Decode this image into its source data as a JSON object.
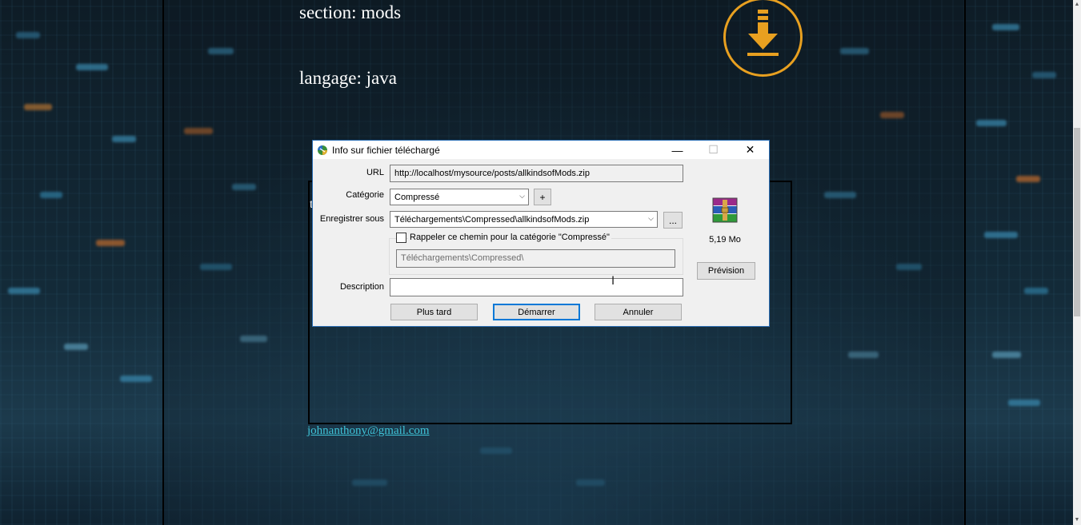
{
  "page": {
    "section_line": "section:  mods",
    "language_line": "langage:  java",
    "box_letter": "t",
    "email": "johnanthony@gmail.com"
  },
  "icons": {
    "download": "download-circle-icon",
    "app": "internet-download-manager-icon",
    "archive": "winrar-archive-icon",
    "minimize": "minimize-icon",
    "maximize": "maximize-icon",
    "close": "close-icon",
    "dropdown": "chevron-down-icon"
  },
  "colors": {
    "accent_orange": "#e8a020",
    "link_cyan": "#3fc3d8",
    "default_button_border": "#0078d7"
  },
  "dialog": {
    "title": "Info sur fichier téléchargé",
    "minimize_glyph": "—",
    "maximize_glyph": "☐",
    "close_glyph": "✕",
    "url_label": "URL",
    "url_value": "http://localhost/mysource/posts/allkindsofMods.zip",
    "category_label": "Catégorie",
    "category_value": "Compressé",
    "add_category_label": "+",
    "save_as_label": "Enregistrer sous",
    "save_as_value": "Téléchargements\\Compressed\\allkindsofMods.zip",
    "browse_label": "...",
    "remember_label": "Rappeler ce chemin pour la catégorie \"Compressé\"",
    "remember_checked": false,
    "remember_path": "Téléchargements\\Compressed\\",
    "description_label": "Description",
    "description_value": "",
    "file_size": "5,19  Mo",
    "preview_label": "Prévision",
    "later_label": "Plus tard",
    "start_label": "Démarrer",
    "cancel_label": "Annuler"
  }
}
